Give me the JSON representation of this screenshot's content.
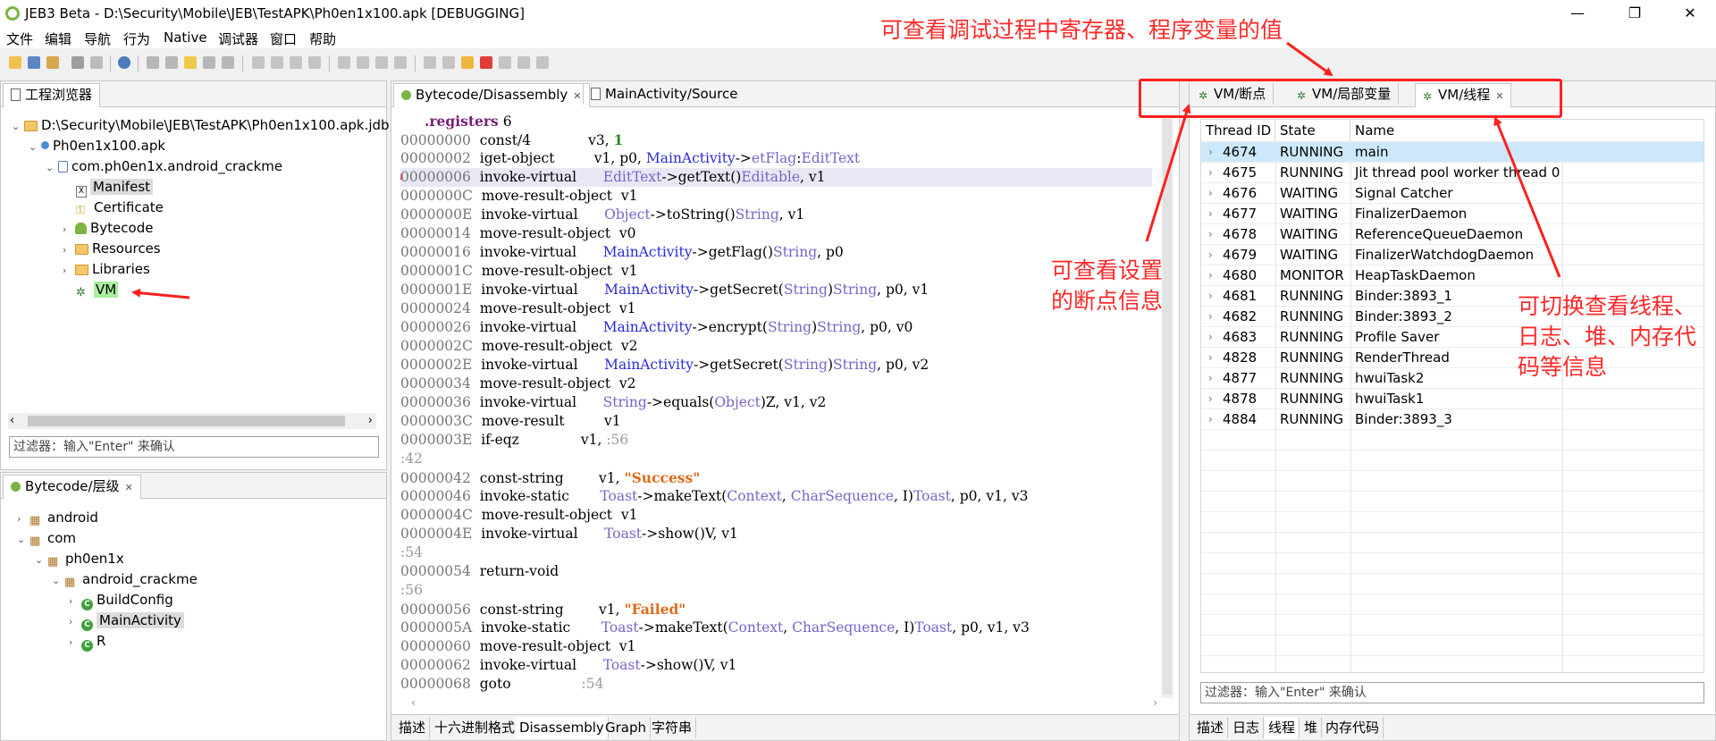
{
  "window": {
    "title": "JEB3 Beta - D:\\Security\\Mobile\\JEB\\TestAPK\\Ph0en1x100.apk [DEBUGGING]",
    "minimize": "—",
    "maximize": "❐",
    "close": "✕"
  },
  "menu": [
    "文件",
    "编辑",
    "导航",
    "行为",
    "Native",
    "调试器",
    "窗口",
    "帮助"
  ],
  "project_panel": {
    "tab": "工程浏览器",
    "tree": [
      {
        "label": "D:\\Security\\Mobile\\JEB\\TestAPK\\Ph0en1x100.apk.jdb"
      },
      {
        "label": "Ph0en1x100.apk"
      },
      {
        "label": "com.ph0en1x.android_crackme"
      },
      {
        "label": "Manifest"
      },
      {
        "label": "Certificate"
      },
      {
        "label": "Bytecode"
      },
      {
        "label": "Resources"
      },
      {
        "label": "Libraries"
      },
      {
        "label": "VM"
      }
    ],
    "filter_placeholder": "过滤器：输入\"Enter\" 来确认"
  },
  "hierarchy_panel": {
    "tab": "Bytecode/层级",
    "tree": [
      {
        "label": "android"
      },
      {
        "label": "com"
      },
      {
        "label": "ph0en1x"
      },
      {
        "label": "android_crackme"
      },
      {
        "label": "BuildConfig"
      },
      {
        "label": "MainActivity"
      },
      {
        "label": "R"
      }
    ]
  },
  "editor": {
    "tabs": [
      "Bytecode/Disassembly",
      "MainActivity/Source"
    ],
    "bottom_tabs": [
      "描述",
      "十六进制格式",
      "Disassembly",
      "Graph",
      "字符串"
    ],
    "lines": [
      {
        "addr": "",
        "parts": [
          [
            "kw",
            "     .registers"
          ],
          [
            "",
            " 6"
          ]
        ]
      },
      {
        "addr": "00000000",
        "parts": [
          [
            "",
            "  const/4             v3, "
          ],
          [
            "num",
            "1"
          ]
        ]
      },
      {
        "addr": "00000002",
        "parts": [
          [
            "",
            "  iget-object         v1, p0, "
          ],
          [
            "cls",
            "MainActivity"
          ],
          [
            "",
            "->"
          ],
          [
            "typ",
            "etFlag"
          ],
          [
            "",
            ":"
          ],
          [
            "typ",
            "EditText"
          ]
        ]
      },
      {
        "addr": "00000006",
        "parts": [
          [
            "",
            "  invoke-virtual      "
          ],
          [
            "typ",
            "EditText"
          ],
          [
            "",
            "->getText()"
          ],
          [
            "typ",
            "Editable"
          ],
          [
            "",
            ", v1"
          ]
        ],
        "breakpoint": true,
        "highlight": true
      },
      {
        "addr": "0000000C",
        "parts": [
          [
            "",
            "  move-result-object  v1"
          ]
        ]
      },
      {
        "addr": "0000000E",
        "parts": [
          [
            "",
            "  invoke-virtual      "
          ],
          [
            "typ",
            "Object"
          ],
          [
            "",
            "->toString()"
          ],
          [
            "typ",
            "String"
          ],
          [
            "",
            ", v1"
          ]
        ]
      },
      {
        "addr": "00000014",
        "parts": [
          [
            "",
            "  move-result-object  v0"
          ]
        ]
      },
      {
        "addr": "00000016",
        "parts": [
          [
            "",
            "  invoke-virtual      "
          ],
          [
            "cls",
            "MainActivity"
          ],
          [
            "",
            "->getFlag()"
          ],
          [
            "typ",
            "String"
          ],
          [
            "",
            ", p0"
          ]
        ]
      },
      {
        "addr": "0000001C",
        "parts": [
          [
            "",
            "  move-result-object  v1"
          ]
        ]
      },
      {
        "addr": "0000001E",
        "parts": [
          [
            "",
            "  invoke-virtual      "
          ],
          [
            "cls",
            "MainActivity"
          ],
          [
            "",
            "->getSecret("
          ],
          [
            "typ",
            "String"
          ],
          [
            "",
            ")"
          ],
          [
            "typ",
            "String"
          ],
          [
            "",
            ", p0, v1"
          ]
        ]
      },
      {
        "addr": "00000024",
        "parts": [
          [
            "",
            "  move-result-object  v1"
          ]
        ]
      },
      {
        "addr": "00000026",
        "parts": [
          [
            "",
            "  invoke-virtual      "
          ],
          [
            "cls",
            "MainActivity"
          ],
          [
            "",
            "->encrypt("
          ],
          [
            "typ",
            "String"
          ],
          [
            "",
            ")"
          ],
          [
            "typ",
            "String"
          ],
          [
            "",
            ", p0, v0"
          ]
        ]
      },
      {
        "addr": "0000002C",
        "parts": [
          [
            "",
            "  move-result-object  v2"
          ]
        ]
      },
      {
        "addr": "0000002E",
        "parts": [
          [
            "",
            "  invoke-virtual      "
          ],
          [
            "cls",
            "MainActivity"
          ],
          [
            "",
            "->getSecret("
          ],
          [
            "typ",
            "String"
          ],
          [
            "",
            ")"
          ],
          [
            "typ",
            "String"
          ],
          [
            "",
            ", p0, v2"
          ]
        ]
      },
      {
        "addr": "00000034",
        "parts": [
          [
            "",
            "  move-result-object  v2"
          ]
        ]
      },
      {
        "addr": "00000036",
        "parts": [
          [
            "",
            "  invoke-virtual      "
          ],
          [
            "typ",
            "String"
          ],
          [
            "",
            "->equals("
          ],
          [
            "typ",
            "Object"
          ],
          [
            "",
            ")Z, v1, v2"
          ]
        ]
      },
      {
        "addr": "0000003C",
        "parts": [
          [
            "",
            "  move-result         v1"
          ]
        ]
      },
      {
        "addr": "0000003E",
        "parts": [
          [
            "",
            "  if-eqz              v1, "
          ],
          [
            "lbl",
            ":56"
          ]
        ]
      },
      {
        "addr": "",
        "parts": [
          [
            "lbl",
            ":42"
          ]
        ]
      },
      {
        "addr": "00000042",
        "parts": [
          [
            "",
            "  const-string        v1, "
          ],
          [
            "str",
            "\"Success\""
          ]
        ]
      },
      {
        "addr": "00000046",
        "parts": [
          [
            "",
            "  invoke-static       "
          ],
          [
            "typ",
            "Toast"
          ],
          [
            "",
            "->makeText("
          ],
          [
            "typ",
            "Context"
          ],
          [
            "",
            ", "
          ],
          [
            "typ",
            "CharSequence"
          ],
          [
            "",
            ", I)"
          ],
          [
            "typ",
            "Toast"
          ],
          [
            "",
            ", p0, v1, v3"
          ]
        ]
      },
      {
        "addr": "0000004C",
        "parts": [
          [
            "",
            "  move-result-object  v1"
          ]
        ]
      },
      {
        "addr": "0000004E",
        "parts": [
          [
            "",
            "  invoke-virtual      "
          ],
          [
            "typ",
            "Toast"
          ],
          [
            "",
            "->show()V, v1"
          ]
        ]
      },
      {
        "addr": "",
        "parts": [
          [
            "lbl",
            ":54"
          ]
        ]
      },
      {
        "addr": "00000054",
        "parts": [
          [
            "",
            "  return-void"
          ]
        ]
      },
      {
        "addr": "",
        "parts": [
          [
            "lbl",
            ":56"
          ]
        ]
      },
      {
        "addr": "00000056",
        "parts": [
          [
            "",
            "  const-string        v1, "
          ],
          [
            "str",
            "\"Failed\""
          ]
        ]
      },
      {
        "addr": "0000005A",
        "parts": [
          [
            "",
            "  invoke-static       "
          ],
          [
            "typ",
            "Toast"
          ],
          [
            "",
            "->makeText("
          ],
          [
            "typ",
            "Context"
          ],
          [
            "",
            ", "
          ],
          [
            "typ",
            "CharSequence"
          ],
          [
            "",
            ", I)"
          ],
          [
            "typ",
            "Toast"
          ],
          [
            "",
            ", p0, v1, v3"
          ]
        ]
      },
      {
        "addr": "00000060",
        "parts": [
          [
            "",
            "  move-result-object  v1"
          ]
        ]
      },
      {
        "addr": "00000062",
        "parts": [
          [
            "",
            "  invoke-virtual      "
          ],
          [
            "typ",
            "Toast"
          ],
          [
            "",
            "->show()V, v1"
          ]
        ]
      },
      {
        "addr": "00000068",
        "parts": [
          [
            "",
            "  goto                "
          ],
          [
            "lbl",
            ":54"
          ]
        ]
      }
    ]
  },
  "vm_panel": {
    "tabs": [
      "VM/断点",
      "VM/局部变量",
      "VM/线程"
    ],
    "columns": [
      "Thread ID",
      "State",
      "Name"
    ],
    "threads": [
      {
        "id": "4674",
        "state": "RUNNING",
        "name": "main",
        "selected": true
      },
      {
        "id": "4675",
        "state": "RUNNING",
        "name": "Jit thread pool worker thread 0"
      },
      {
        "id": "4676",
        "state": "WAITING",
        "name": "Signal Catcher"
      },
      {
        "id": "4677",
        "state": "WAITING",
        "name": "FinalizerDaemon"
      },
      {
        "id": "4678",
        "state": "WAITING",
        "name": "ReferenceQueueDaemon"
      },
      {
        "id": "4679",
        "state": "WAITING",
        "name": "FinalizerWatchdogDaemon"
      },
      {
        "id": "4680",
        "state": "MONITOR",
        "name": "HeapTaskDaemon"
      },
      {
        "id": "4681",
        "state": "RUNNING",
        "name": "Binder:3893_1"
      },
      {
        "id": "4682",
        "state": "RUNNING",
        "name": "Binder:3893_2"
      },
      {
        "id": "4683",
        "state": "RUNNING",
        "name": "Profile Saver"
      },
      {
        "id": "4828",
        "state": "RUNNING",
        "name": "RenderThread"
      },
      {
        "id": "4877",
        "state": "RUNNING",
        "name": "hwuiTask2"
      },
      {
        "id": "4878",
        "state": "RUNNING",
        "name": "hwuiTask1"
      },
      {
        "id": "4884",
        "state": "RUNNING",
        "name": "Binder:3893_3"
      }
    ],
    "filter_placeholder": "过滤器：输入\"Enter\" 来确认",
    "bottom_tabs": [
      "描述",
      "日志",
      "线程",
      "堆",
      "内存代码"
    ]
  },
  "annotations": {
    "top": "可查看调试过程中寄存器、程序变量的值",
    "breakpoint": "可查看设置\n的断点信息",
    "threads": "可切换查看线程、\n日志、堆、内存代\n码等信息"
  },
  "colors": {
    "annotation_red": "#ff2a2a",
    "selected_row": "#cde8fa",
    "breakpoint": "#e0556a"
  }
}
